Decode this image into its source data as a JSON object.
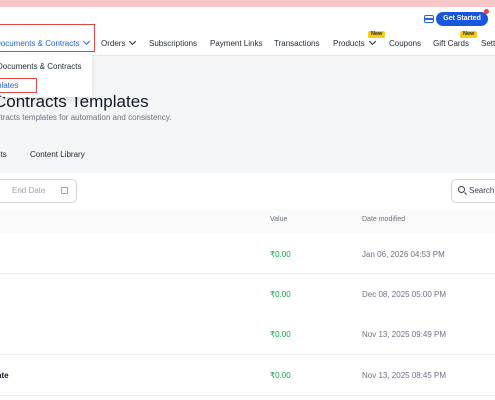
{
  "header": {
    "get_started_label": "Get Started"
  },
  "nav": {
    "items": [
      {
        "label": "Documents & Contracts",
        "badge": ""
      },
      {
        "label": "Orders",
        "badge": ""
      },
      {
        "label": "Subscriptions",
        "badge": ""
      },
      {
        "label": "Payment Links",
        "badge": ""
      },
      {
        "label": "Transactions",
        "badge": ""
      },
      {
        "label": "Products",
        "badge": "New"
      },
      {
        "label": "Coupons",
        "badge": ""
      },
      {
        "label": "Gift Cards",
        "badge": "New"
      },
      {
        "label": "Sett",
        "badge": ""
      }
    ]
  },
  "dropdown": {
    "items": [
      "Documents & Contracts",
      "plates"
    ]
  },
  "page": {
    "title": "Contracts Templates",
    "subtitle": "ntracts templates for automation and consistency."
  },
  "tabs": [
    "nts",
    "Content Library"
  ],
  "filters": {
    "end_date_placeholder": "End Date",
    "search_placeholder": "Search"
  },
  "table": {
    "headers": {
      "value": "Value",
      "date_modified": "Date modified"
    },
    "rows": [
      {
        "name": "",
        "value": "₹0.00",
        "date": "Jan 06, 2026 04:53 PM"
      },
      {
        "name": "",
        "value": "₹0.00",
        "date": "Dec 08, 2025 05:00 PM"
      },
      {
        "name": "",
        "value": "₹0.00",
        "date": "Nov 13, 2025 09:49 PM"
      },
      {
        "name": "ate",
        "value": "₹0.00",
        "date": "Nov 13, 2025 08:45 PM"
      }
    ]
  },
  "colors": {
    "accent": "#2563eb",
    "primary_button": "#1a56db",
    "highlight": "#e64545",
    "value_green": "#16a34a"
  },
  "icons": [
    "card-icon",
    "chevron-down-icon",
    "calendar-icon",
    "search-icon"
  ]
}
